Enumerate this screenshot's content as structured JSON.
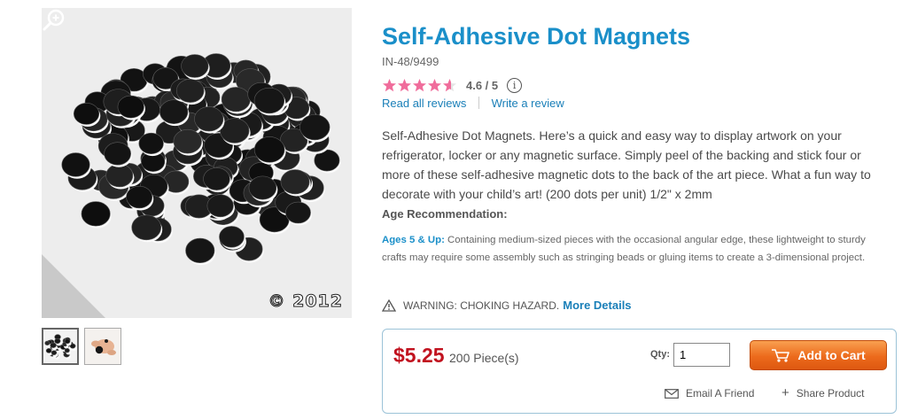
{
  "product": {
    "title": "Self-Adhesive Dot Magnets",
    "sku": "IN-48/9499",
    "rating": {
      "stars": 4.6,
      "score_label": "4.6 / 5",
      "info_icon": "info-icon"
    },
    "links": {
      "read_reviews": "Read all reviews",
      "write_review": "Write a review"
    },
    "description": "Self-Adhesive Dot Magnets. Here’s a quick and easy way to display artwork on your refrigerator, locker or any magnetic surface. Simply peel of the backing and stick four or more of these self-adhesive magnetic dots to the back of the art piece. What a fun way to decorate with your child’s art! (200 dots per unit) 1/2\" x 2mm",
    "age": {
      "heading": "Age Recommendation:",
      "label": "Ages 5 & Up:",
      "text": " Containing medium-sized pieces with the occasional angular edge, these lightweight to sturdy crafts may require some assembly such as stringing beads or gluing items to create a 3-dimensional project."
    },
    "warning": {
      "text": "WARNING: CHOKING HAZARD.",
      "more": "More Details"
    }
  },
  "image": {
    "copyright": "© 2012",
    "zoom_icon": "zoom-icon"
  },
  "purchase": {
    "price": "$5.25",
    "unit": "200 Piece(s)",
    "qty_label": "Qty:",
    "qty_value": "1",
    "add_to_cart": "Add to Cart",
    "email_friend": "Email A Friend",
    "share_plus": "+",
    "share_product": "Share Product"
  },
  "colors": {
    "title": "#1a8fc9",
    "price": "#c1121f",
    "stars": "#f06c9b",
    "cart_button": "#ec6a1c"
  }
}
